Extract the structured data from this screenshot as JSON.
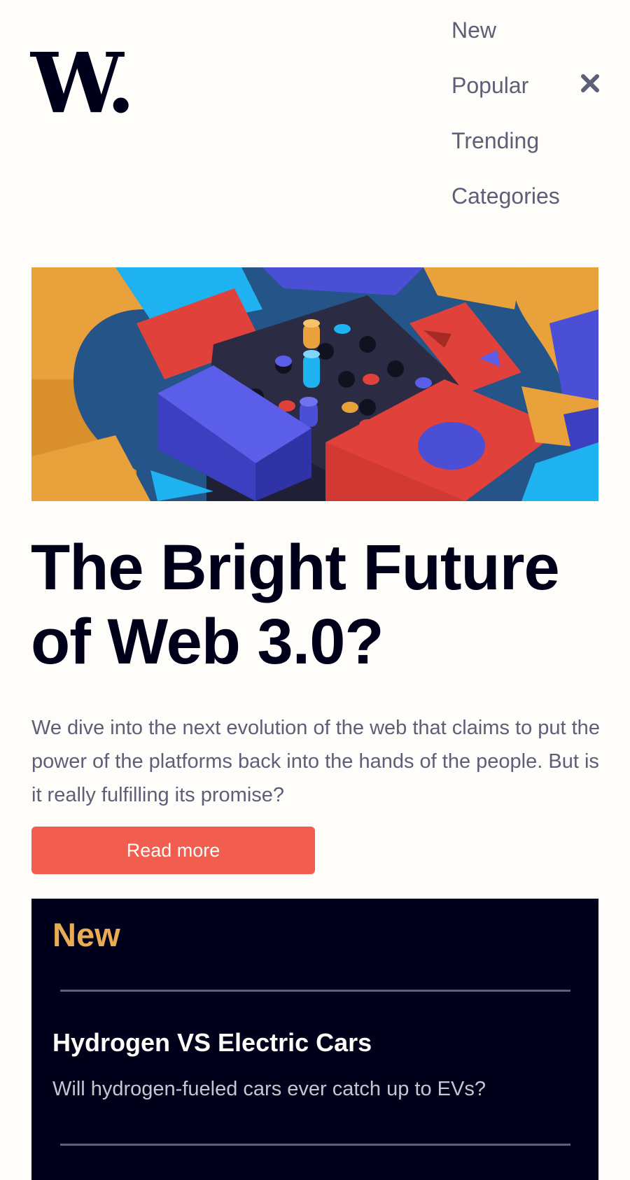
{
  "header": {
    "logo_text": "W."
  },
  "nav": {
    "items": [
      "New",
      "Popular",
      "Trending",
      "Categories"
    ]
  },
  "hero": {
    "title_line1": "The Bright Future",
    "title_line2": "of Web 3.0?",
    "excerpt": "We dive into the next evolution of the web that claims to put the power of the platforms back into the hands of the people. But is it really fulfilling its promise?",
    "button_label": "Read more"
  },
  "new_section": {
    "heading": "New",
    "items": [
      {
        "title": "Hydrogen VS Electric Cars",
        "description": "Will hydrogen-fueled cars ever catch up to EVs?"
      }
    ]
  },
  "colors": {
    "background": "#fffdfa",
    "dark": "#00001a",
    "text_muted": "#5d5f79",
    "accent_red": "#f15e50",
    "accent_orange": "#e9ab53"
  },
  "icons": {
    "close": "close-icon"
  }
}
